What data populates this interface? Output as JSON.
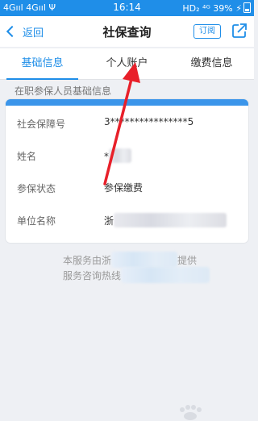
{
  "status_bar": {
    "signal_left": "4Gııl 4Gııl Ψ",
    "time": "16:14",
    "right": "HD₂ ⁴ᴳ 39%"
  },
  "nav": {
    "back_label": "返回",
    "title": "社保查询",
    "subscribe_label": "订阅"
  },
  "tabs": [
    {
      "label": "基础信息",
      "active": true
    },
    {
      "label": "个人账户",
      "active": false
    },
    {
      "label": "缴费信息",
      "active": false
    }
  ],
  "section": {
    "title": "在职参保人员基础信息"
  },
  "card": {
    "rows": [
      {
        "label": "社会保障号",
        "value": "3****************5"
      },
      {
        "label": "姓名",
        "value": "*"
      },
      {
        "label": "参保状态",
        "value": "参保缴费"
      },
      {
        "label": "单位名称",
        "value": "浙"
      }
    ]
  },
  "footer": {
    "line1_prefix": "本服务由浙",
    "line1_suffix": "提供",
    "line2_prefix": "服务咨询热线"
  },
  "colors": {
    "accent": "#1f8ee8",
    "annotation_arrow": "#e8202a"
  },
  "icons": {
    "back": "chevron-left-icon",
    "share": "share-icon",
    "battery": "battery-icon"
  }
}
